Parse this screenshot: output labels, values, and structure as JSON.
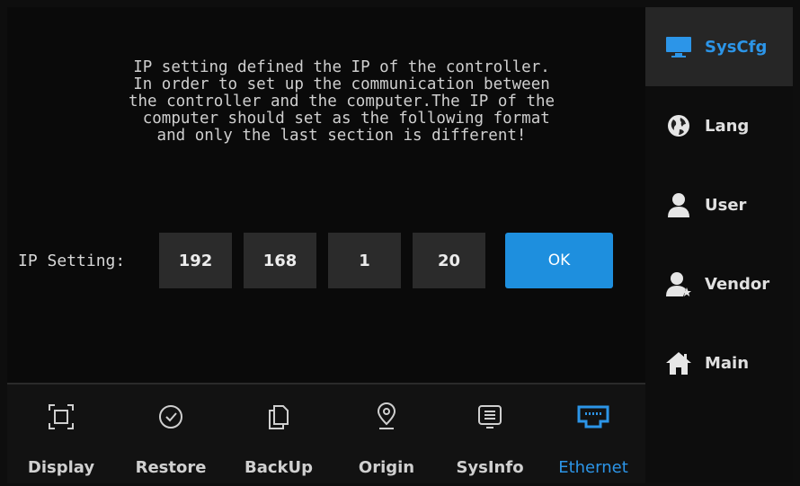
{
  "description": "IP setting defined the IP of the controller.\nIn order to set up the communication between\nthe controller and the computer.The IP of the\n computer should set as the following format\nand only the last section is different!",
  "ip_setting": {
    "label": "IP Setting:",
    "octets": [
      "192",
      "168",
      "1",
      "20"
    ],
    "ok_label": "OK"
  },
  "sidebar": {
    "items": [
      {
        "label": "SysCfg",
        "icon": "monitor-icon",
        "active": true
      },
      {
        "label": "Lang",
        "icon": "globe-icon"
      },
      {
        "label": "User",
        "icon": "user-icon"
      },
      {
        "label": "Vendor",
        "icon": "vendor-user-icon"
      },
      {
        "label": "Main",
        "icon": "home-icon"
      }
    ]
  },
  "bottom_tabs": [
    {
      "label": "Display",
      "icon": "display-frame-icon"
    },
    {
      "label": "Restore",
      "icon": "clock-icon"
    },
    {
      "label": "BackUp",
      "icon": "copy-icon"
    },
    {
      "label": "Origin",
      "icon": "location-pin-icon"
    },
    {
      "label": "SysInfo",
      "icon": "info-list-icon"
    },
    {
      "label": "Ethernet",
      "icon": "ethernet-port-icon",
      "active": true
    }
  ],
  "colors": {
    "accent": "#1e8fde",
    "active_text": "#2c95e8",
    "field_bg": "#2b2b2b",
    "background": "#0b0b0b"
  }
}
